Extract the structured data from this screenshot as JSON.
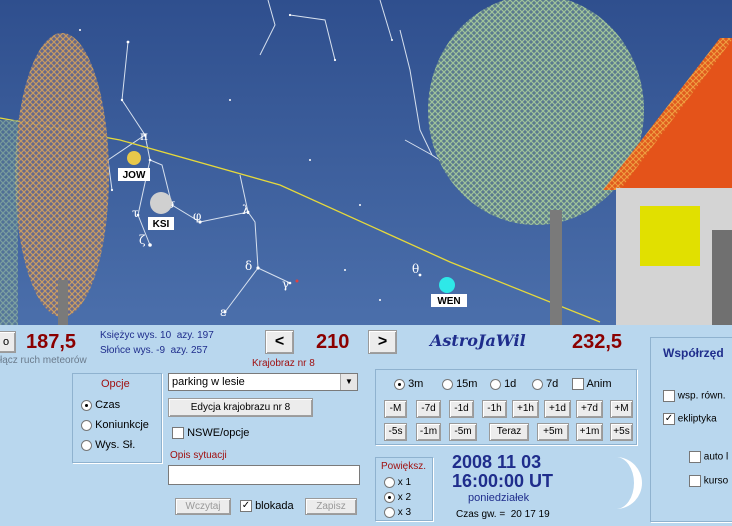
{
  "sky": {
    "planets": [
      {
        "name": "JOW",
        "icon": "jupiter-marker",
        "color": "#e8c84a"
      },
      {
        "name": "KSI",
        "icon": "moon-marker",
        "color": "#d0d0d0"
      },
      {
        "name": "WEN",
        "icon": "venus-marker",
        "color": "#2ee8e8"
      }
    ],
    "greek": [
      "π",
      "σ",
      "τ",
      "φ",
      "ζ",
      "λ",
      "δ",
      "γ",
      "ε",
      "θ",
      "η"
    ]
  },
  "top_left_button": "o",
  "hint_meteor": "łącz ruch meteorów",
  "azimuth_left": "187,5",
  "azimuth_center": "210",
  "azimuth_right": "232,5",
  "moon_info": "Księżyc wys. 10  azy. 197",
  "sun_info": "Słońce wys. -9  azy. 257",
  "prev_label": "<",
  "next_label": ">",
  "landscape_label": "Krajobraz nr 8",
  "app_title": "AstroJaWil",
  "options": {
    "title": "Opcje",
    "items": [
      {
        "label": "Czas",
        "selected": true
      },
      {
        "label": "Koniunkcje",
        "selected": false
      },
      {
        "label": "Wys. Sł.",
        "selected": false
      }
    ]
  },
  "landscape_select": {
    "value": "parking w lesie"
  },
  "edit_landscape": "Edycja krajobrazu nr 8",
  "nswe": {
    "label": "NSWE/opcje",
    "checked": false
  },
  "description": {
    "label": "Opis sytuacji",
    "value": ""
  },
  "load_button": "Wczytaj",
  "lock": {
    "label": "blokada",
    "checked": true
  },
  "save_button": "Zapisz",
  "step_options": [
    {
      "label": "3m",
      "selected": true
    },
    {
      "label": "15m",
      "selected": false
    },
    {
      "label": "1d",
      "selected": false
    },
    {
      "label": "7d",
      "selected": false
    }
  ],
  "anim": {
    "label": "Anim",
    "checked": false
  },
  "row1": [
    "-M",
    "-7d",
    "-1d",
    "-1h",
    "+1h",
    "+1d",
    "+7d",
    "+M"
  ],
  "row2": [
    "-5s",
    "-1m",
    "-5m",
    "Teraz",
    "+5m",
    "+1m",
    "+5s"
  ],
  "zoom": {
    "title": "Powiększ.",
    "items": [
      {
        "label": "x 1",
        "selected": false
      },
      {
        "label": "x 2",
        "selected": true
      },
      {
        "label": "x 3",
        "selected": false
      }
    ]
  },
  "date": "2008 11 03",
  "time": "16:00:00 UT",
  "weekday": "poniedziałek",
  "sidereal": "Czas gw. =  20 17 19",
  "coords": {
    "title": "Współrzęd",
    "items": [
      {
        "label": "wsp. równ.",
        "checked": false
      },
      {
        "label": "ekliptyka",
        "checked": true
      },
      {
        "label": "auto l",
        "checked": false
      },
      {
        "label": "kurso",
        "checked": false
      }
    ]
  },
  "colors": {
    "accent": "#8b0000",
    "navy": "#1f2d8c",
    "sky": "#3c5f9c",
    "ecliptic": "#e6d93b"
  }
}
